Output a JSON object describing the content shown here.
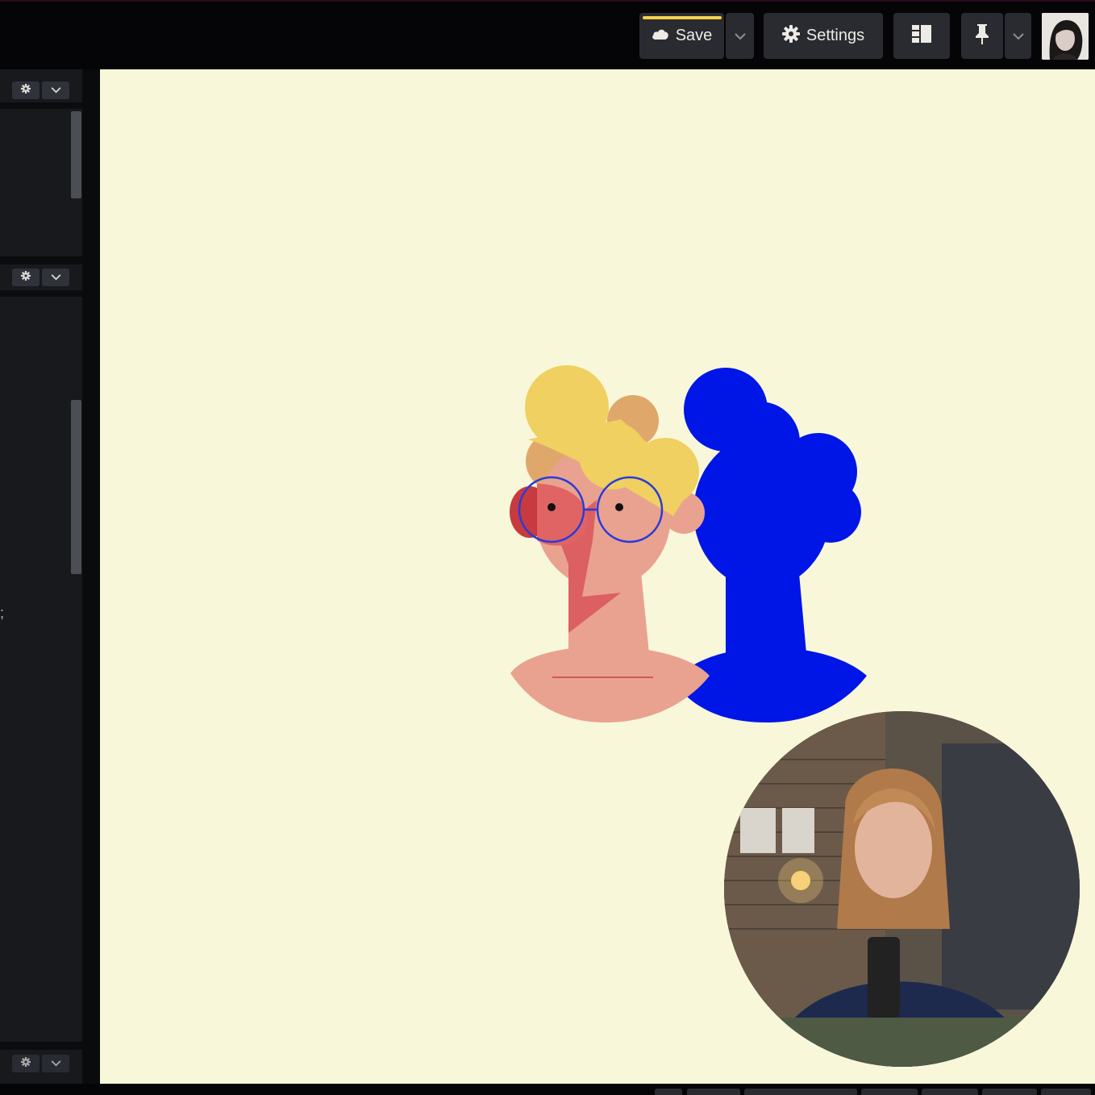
{
  "toolbar": {
    "save_label": "Save",
    "settings_label": "Settings"
  },
  "icons": {
    "save": "cloud-icon",
    "save_menu": "chevron-down-icon",
    "settings": "gear-icon",
    "layout": "layout-panels-icon",
    "pin": "pin-icon",
    "pin_menu": "chevron-down-icon",
    "panel_settings": "gear-icon",
    "panel_collapse": "chevron-down-icon"
  },
  "colors": {
    "canvas_bg": "#f8f7d9",
    "save_accent": "#f2d04b",
    "figure_blue": "#0016e6",
    "figure_skin": "#e9a290",
    "figure_hair": "#efd060",
    "figure_hair_back": "#e0a76a",
    "figure_cheek": "#d9545a",
    "glasses": "#2a3bd8"
  },
  "left_panel": {
    "stray_glyph": ";"
  }
}
